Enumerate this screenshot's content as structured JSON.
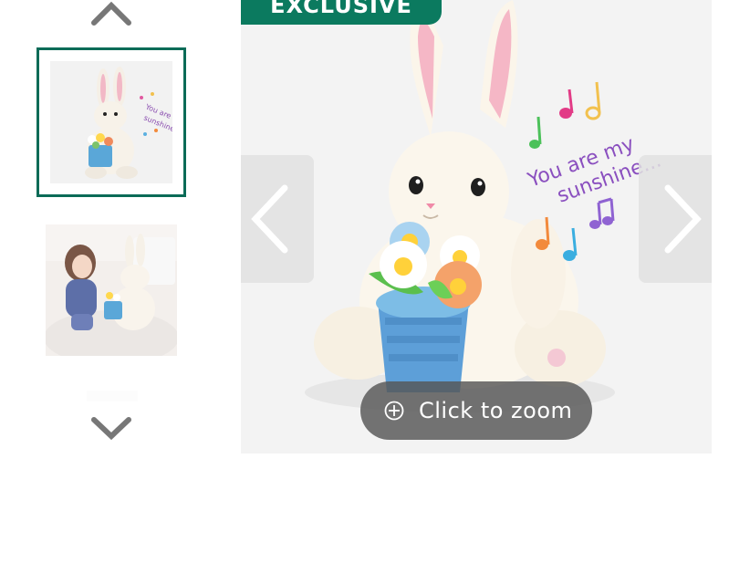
{
  "gallery": {
    "badge_label": "EXCLUSIVE",
    "zoom_label": "Click to zoom",
    "thumbnails": [
      {
        "alt": "Bunny plush with flowers",
        "selected": true
      },
      {
        "alt": "Child holding bunny plush",
        "selected": false
      },
      {
        "alt": "Additional view",
        "selected": false
      }
    ],
    "illustration_text": [
      "You are my",
      "sunshine..."
    ],
    "thumb_text": [
      "You are my",
      "sunshine"
    ]
  },
  "colors": {
    "accent": "#0b6b57",
    "badge": "#0b7a5f"
  }
}
